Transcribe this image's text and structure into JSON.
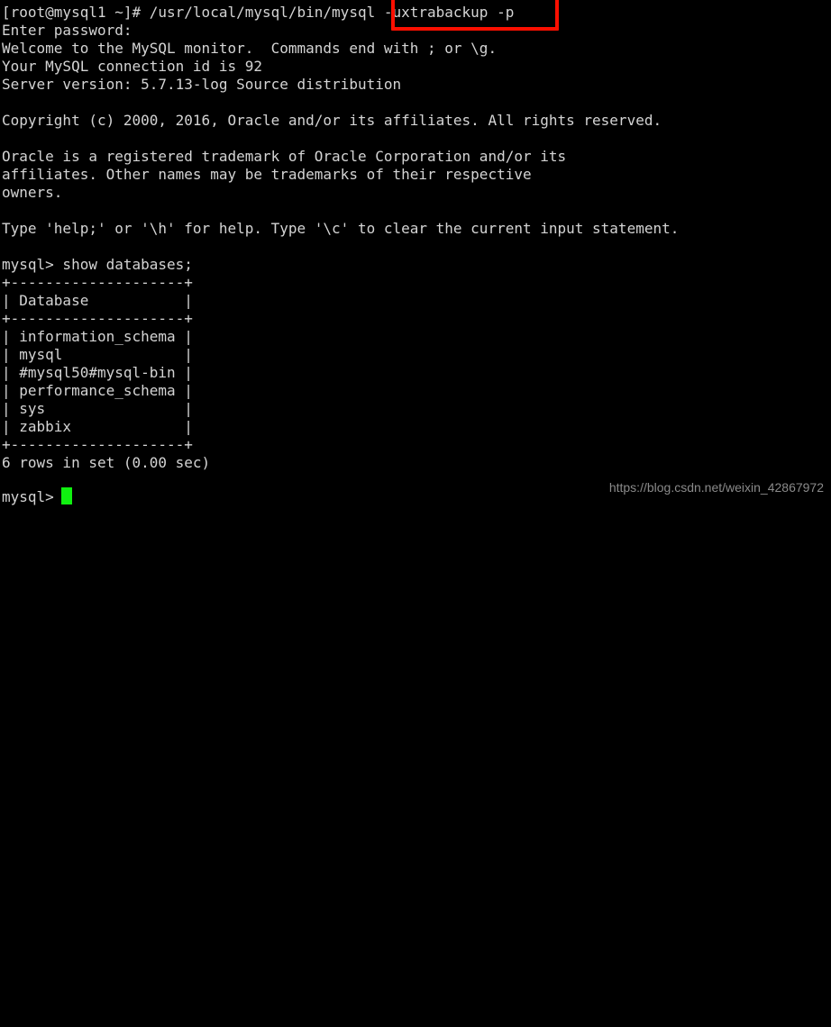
{
  "terminal": {
    "background_color": "#000000",
    "text_color": "#d4d4d4",
    "cursor_color": "#10f010",
    "prompt_host": "[root@mysql1 ~]#",
    "lines": [
      "[root@mysql1 ~]# /usr/local/mysql/bin/mysql -uxtrabackup -p",
      "Enter password:",
      "Welcome to the MySQL monitor.  Commands end with ; or \\g.",
      "Your MySQL connection id is 92",
      "Server version: 5.7.13-log Source distribution",
      "",
      "Copyright (c) 2000, 2016, Oracle and/or its affiliates. All rights reserved.",
      "",
      "Oracle is a registered trademark of Oracle Corporation and/or its",
      "affiliates. Other names may be trademarks of their respective",
      "owners.",
      "",
      "Type 'help;' or '\\h' for help. Type '\\c' to clear the current input statement.",
      "",
      "mysql> show databases;",
      "+--------------------+",
      "| Database           |",
      "+--------------------+",
      "| information_schema |",
      "| mysql              |",
      "| #mysql50#mysql-bin |",
      "| performance_schema |",
      "| sys                |",
      "| zabbix             |",
      "+--------------------+",
      "6 rows in set (0.00 sec)",
      "",
      "mysql> "
    ]
  },
  "command": {
    "full": "/usr/local/mysql/bin/mysql -uxtrabackup -p",
    "binary_path": "/usr/local/mysql/bin/mysql",
    "highlighted_args": "-uxtrabackup -p",
    "password_prompt": "Enter password:"
  },
  "mysql_banner": {
    "welcome": "Welcome to the MySQL monitor.  Commands end with ; or \\g.",
    "connection_id_line": "Your MySQL connection id is 92",
    "connection_id": "92",
    "server_version_line": "Server version: 5.7.13-log Source distribution",
    "server_version": "5.7.13-log",
    "server_distribution": "Source distribution",
    "copyright": "Copyright (c) 2000, 2016, Oracle and/or its affiliates. All rights reserved.",
    "trademark_line_1": "Oracle is a registered trademark of Oracle Corporation and/or its",
    "trademark_line_2": "affiliates. Other names may be trademarks of their respective",
    "trademark_line_3": "owners.",
    "help_hint": "Type 'help;' or '\\h' for help. Type '\\c' to clear the current input statement."
  },
  "query": {
    "prompt": "mysql> ",
    "sql": "show databases;",
    "full_line": "mysql> show databases;"
  },
  "result_table": {
    "separator": "+--------------------+",
    "header_row": "| Database           |",
    "column_header": "Database",
    "rows": [
      "| information_schema |",
      "| mysql              |",
      "| #mysql50#mysql-bin |",
      "| performance_schema |",
      "| sys                |",
      "| zabbix             |"
    ],
    "values": [
      "information_schema",
      "mysql",
      "#mysql50#mysql-bin",
      "performance_schema",
      "sys",
      "zabbix"
    ],
    "status": "6 rows in set (0.00 sec)",
    "row_count": "6",
    "elapsed": "0.00 sec"
  },
  "final_prompt": {
    "text": "mysql> "
  },
  "annotation": {
    "type": "rectangle",
    "color": "#fb0f00",
    "target_text": "-uxtrabackup -p"
  },
  "watermark": {
    "text": "https://blog.csdn.net/weixin_42867972",
    "color": "#8a8a8a"
  }
}
